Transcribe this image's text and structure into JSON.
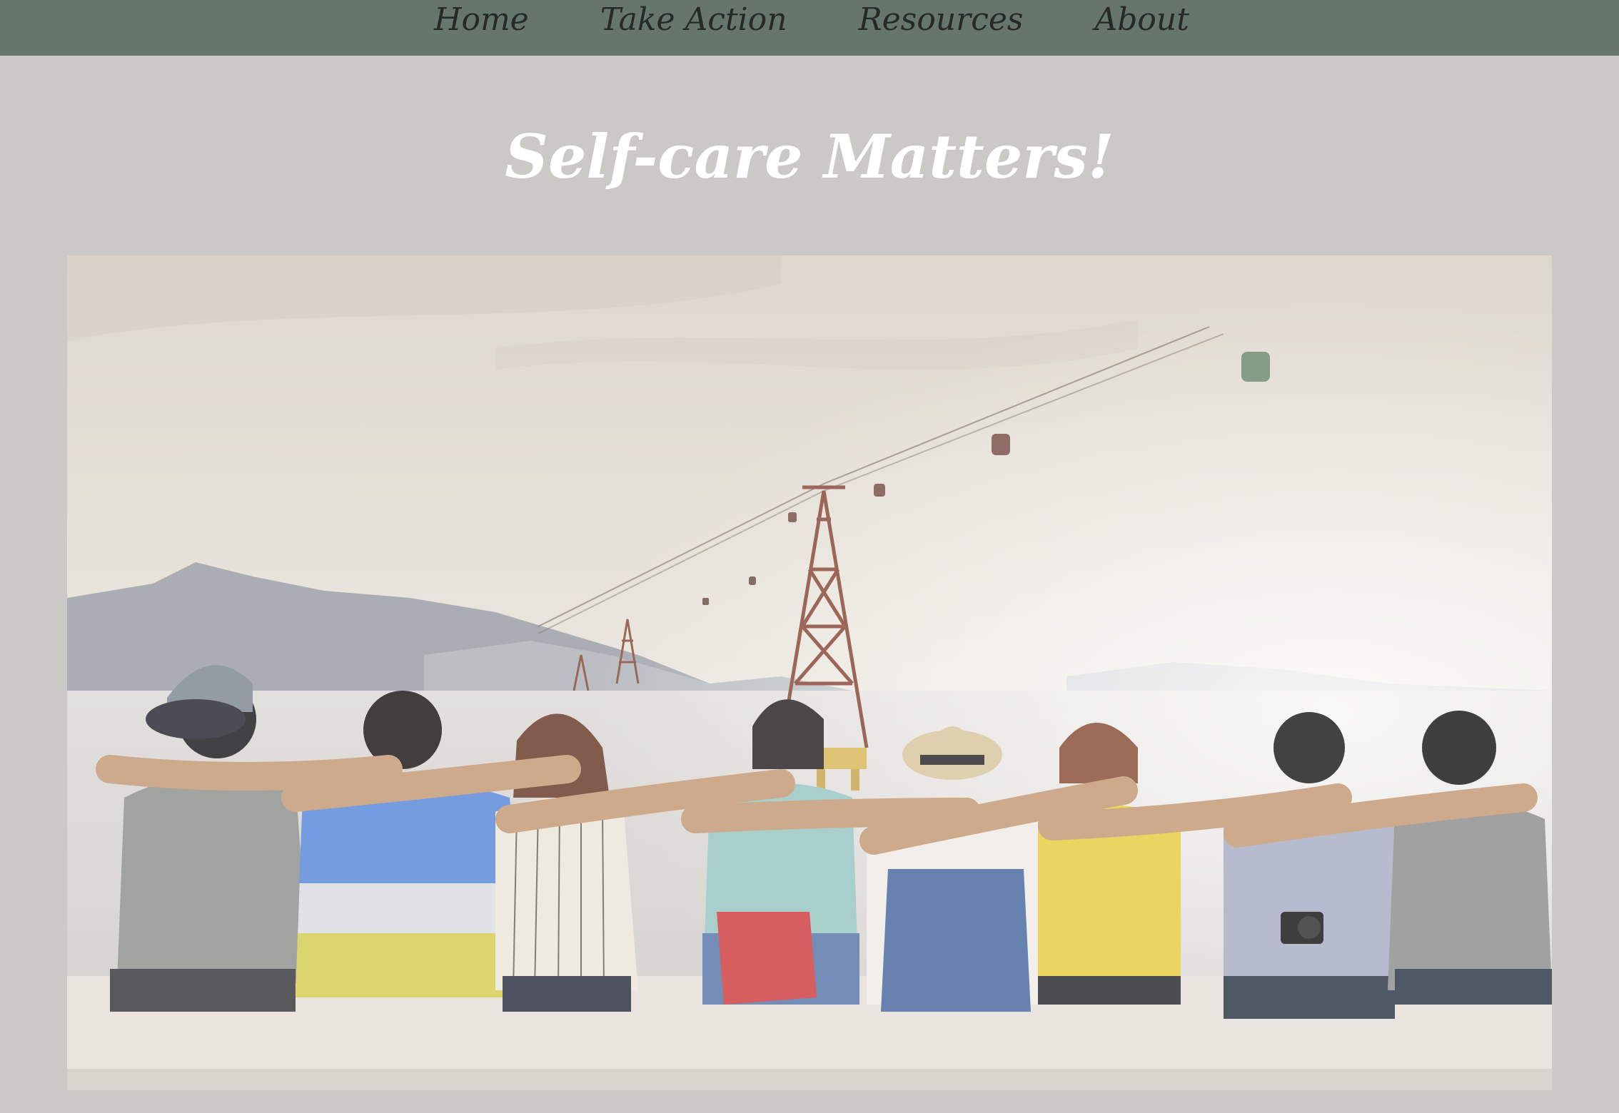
{
  "nav": {
    "items": [
      {
        "label": "Home"
      },
      {
        "label": "Take Action"
      },
      {
        "label": "Resources"
      },
      {
        "label": "About"
      }
    ]
  },
  "page": {
    "title": "Self-care Matters!"
  },
  "hero_image": {
    "icon": "photo-friends-sitting-by-sea-icon"
  },
  "colors": {
    "nav_background": "#66766b",
    "page_background": "#cbc9c5",
    "nav_text": "#252a27",
    "title_text": "#ffffff"
  }
}
